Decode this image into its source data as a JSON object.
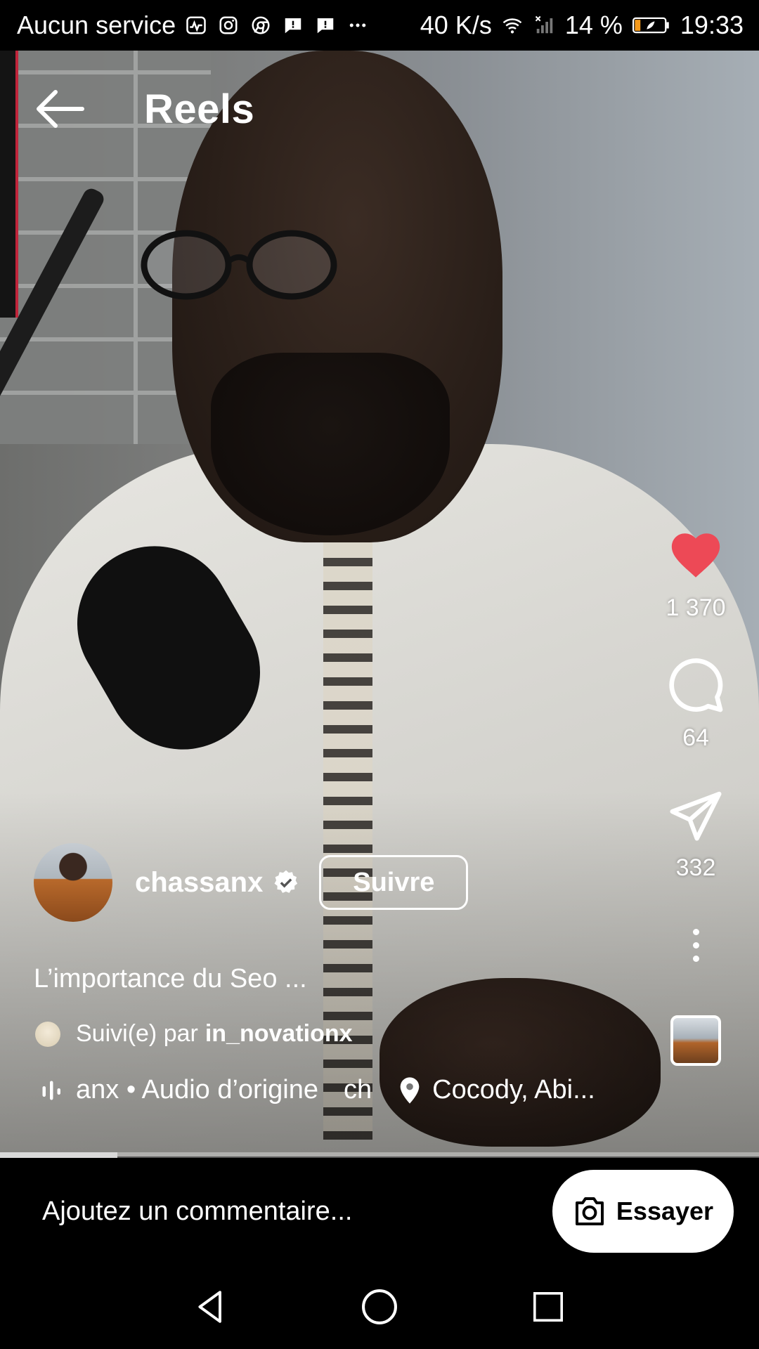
{
  "status_bar": {
    "carrier": "Aucun service",
    "speed": "40 K/s",
    "battery": "14 %",
    "time": "19:33",
    "left_icons": [
      "activity-icon",
      "instagram-icon",
      "chrome-icon",
      "message-icon",
      "message-icon",
      "more-dots-icon"
    ],
    "right_icons": [
      "wifi-icon",
      "signal-icon",
      "battery-icon"
    ]
  },
  "header": {
    "title": "Reels"
  },
  "rail": {
    "like_count": "1 370",
    "comment_count": "64",
    "share_count": "332",
    "like_color": "#ed4956"
  },
  "creator": {
    "username": "chassanx",
    "follow_label": "Suivre"
  },
  "caption": "L’importance du Seo ...",
  "followed_by": {
    "prefix": "Suivi(e) par",
    "user": "in_novationx"
  },
  "meta": {
    "audio": "anx • Audio d’origine",
    "audio_suffix": "ch",
    "location": "Cocody, Abi..."
  },
  "progress": {
    "fraction": 0.155
  },
  "comment_bar": {
    "placeholder": "Ajoutez un commentaire...",
    "try_label": "Essayer"
  }
}
